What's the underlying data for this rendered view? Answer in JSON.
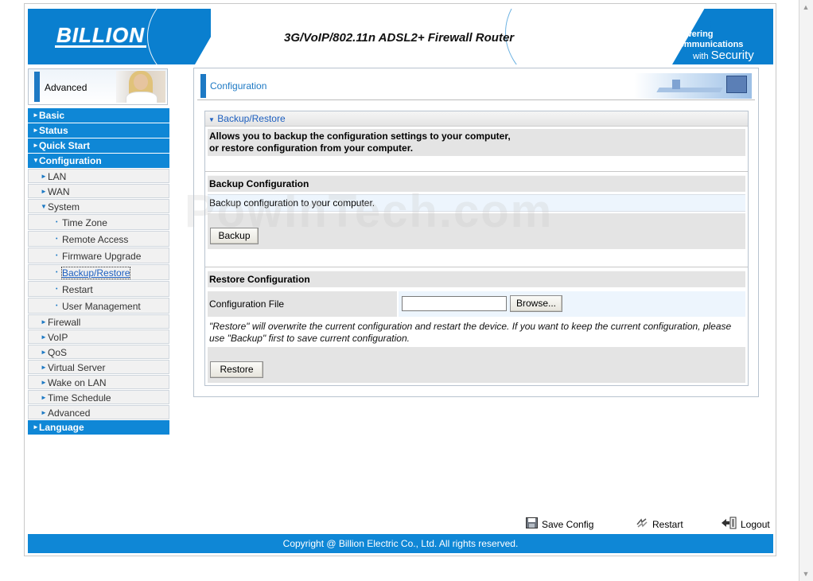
{
  "header": {
    "logo": "BILLION",
    "product_title": "3G/VoIP/802.11n ADSL2+ Firewall Router",
    "slogan_line1": "Powering communications",
    "slogan_line2_small": "with",
    "slogan_line2_big": "Security"
  },
  "sidebar": {
    "mode_label": "Advanced",
    "menu": [
      {
        "label": "Basic",
        "level": 0,
        "arrow": "►"
      },
      {
        "label": "Status",
        "level": 0,
        "arrow": "►"
      },
      {
        "label": "Quick Start",
        "level": 0,
        "arrow": "►"
      },
      {
        "label": "Configuration",
        "level": 0,
        "arrow": "▼"
      },
      {
        "label": "LAN",
        "level": 1,
        "arrow": "►"
      },
      {
        "label": "WAN",
        "level": 1,
        "arrow": "►"
      },
      {
        "label": "System",
        "level": 1,
        "arrow": "▼"
      },
      {
        "label": "Time Zone",
        "level": 2,
        "arrow": "•"
      },
      {
        "label": "Remote Access",
        "level": 2,
        "arrow": "•"
      },
      {
        "label": "Firmware Upgrade",
        "level": 2,
        "arrow": "•"
      },
      {
        "label": "Backup/Restore",
        "level": 2,
        "arrow": "•",
        "active": true
      },
      {
        "label": "Restart",
        "level": 2,
        "arrow": "•"
      },
      {
        "label": "User Management",
        "level": 2,
        "arrow": "•"
      },
      {
        "label": "Firewall",
        "level": 1,
        "arrow": "►"
      },
      {
        "label": "VoIP",
        "level": 1,
        "arrow": "►"
      },
      {
        "label": "QoS",
        "level": 1,
        "arrow": "►"
      },
      {
        "label": "Virtual Server",
        "level": 1,
        "arrow": "►"
      },
      {
        "label": "Wake on LAN",
        "level": 1,
        "arrow": "►"
      },
      {
        "label": "Time Schedule",
        "level": 1,
        "arrow": "►"
      },
      {
        "label": "Advanced",
        "level": 1,
        "arrow": "►"
      },
      {
        "label": "Language",
        "level": 0,
        "arrow": "►"
      }
    ]
  },
  "content": {
    "section_title": "Configuration",
    "panel_title": "Backup/Restore",
    "panel_arrow": "▼",
    "intro_line1": "Allows you to backup the configuration settings to your computer,",
    "intro_line2": "or restore configuration from your computer.",
    "backup": {
      "heading": "Backup Configuration",
      "description": "Backup configuration to your computer.",
      "button": "Backup"
    },
    "restore": {
      "heading": "Restore Configuration",
      "file_label": "Configuration File",
      "file_value": "",
      "browse_button": "Browse...",
      "note": "\"Restore\" will overwrite the current configuration and restart the device. If you want to keep the current configuration, please use \"Backup\" first to save current configuration.",
      "button": "Restore"
    }
  },
  "footer": {
    "save_config": "Save Config",
    "restart": "Restart",
    "logout": "Logout",
    "copyright": "Copyright @ Billion Electric Co., Ltd. All rights reserved."
  },
  "watermark": "PowInTech.com",
  "colors": {
    "brand_blue": "#0f87d6",
    "accent_blue": "#1d79c4",
    "panel_grey": "#e4e4e4",
    "row_light": "#edf5fd"
  }
}
